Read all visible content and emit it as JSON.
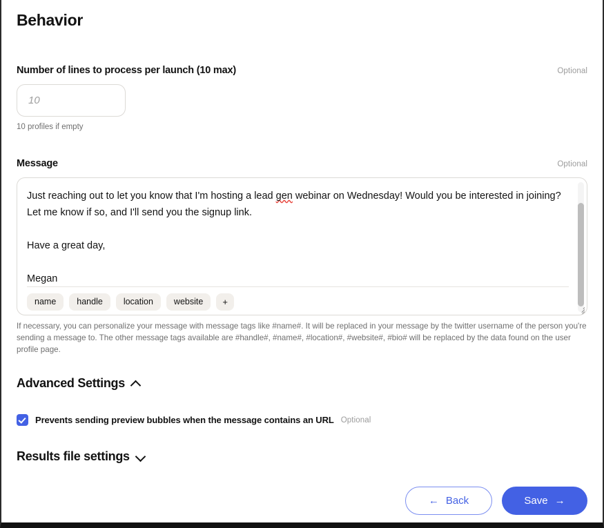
{
  "page": {
    "title": "Behavior"
  },
  "lines_field": {
    "label": "Number of lines to process per launch (10 max)",
    "optional": "Optional",
    "value": "",
    "placeholder": "10",
    "hint": "10 profiles if empty"
  },
  "message_field": {
    "label": "Message",
    "optional": "Optional",
    "text_part_1": "Just reaching out to let you know that I'm hosting a lead ",
    "text_misspelled": "gen",
    "text_part_2": " webinar on Wednesday! Would you be interested in joining?  Let me know if so, and I'll send you the signup link.\n\nHave a great day,\n\nMegan",
    "tags": [
      "name",
      "handle",
      "location",
      "website",
      "+"
    ],
    "help": "If necessary, you can personalize your message with message tags like #name#. It will be replaced in your message by the twitter username of the person you're sending a message to. The other message tags available are #handle#, #name#, #location#, #website#, #bio# will be replaced by the data found on the user profile page."
  },
  "advanced_settings": {
    "title": "Advanced Settings",
    "chevron": "chevron-up-icon",
    "checkbox": {
      "checked": true,
      "label": "Prevents sending preview bubbles when the message contains an URL",
      "optional": "Optional"
    }
  },
  "results_settings": {
    "title": "Results file settings",
    "chevron": "chevron-down-icon"
  },
  "footer": {
    "back_label": "Back",
    "back_arrow": "←",
    "save_label": "Save",
    "save_arrow": "→"
  },
  "colors": {
    "accent_blue": "#4361e4",
    "back_border": "#7b8ef0",
    "chip_bg": "#f2efeb",
    "muted_text": "#6f6f6f",
    "optional_text": "#9b9b9b",
    "spellcheck_red": "#e8453c"
  }
}
